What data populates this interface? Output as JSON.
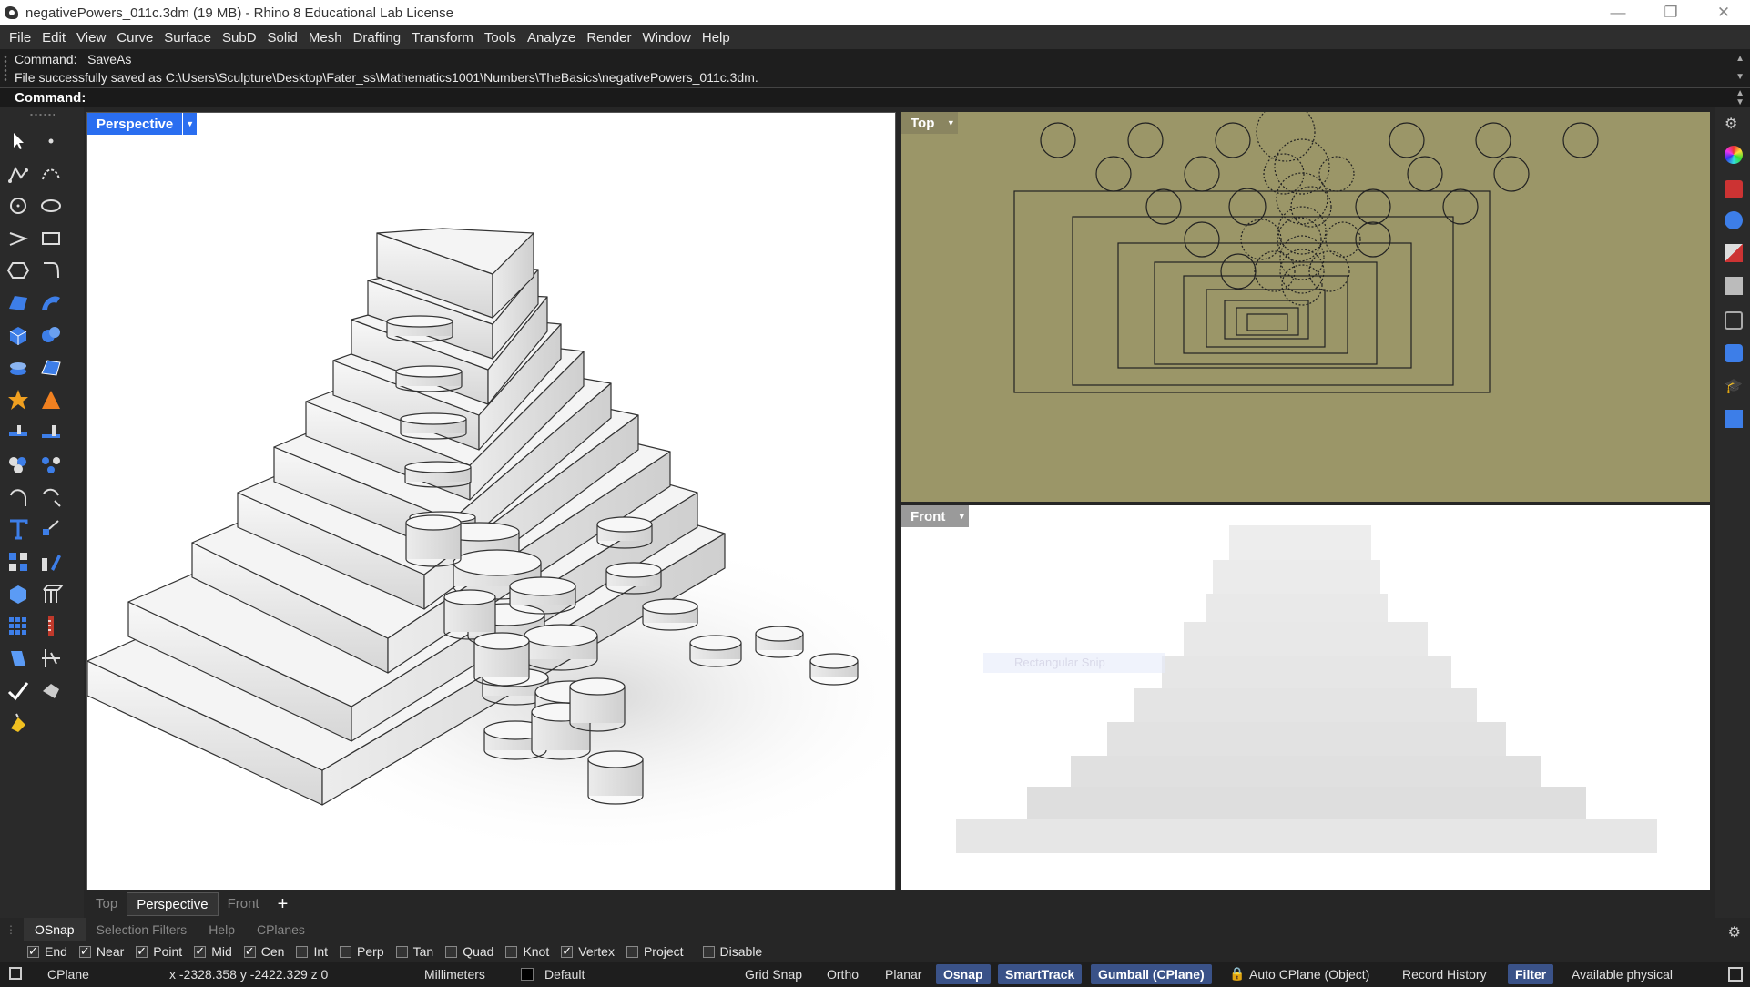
{
  "window": {
    "title": "negativePowers_011c.3dm (19 MB) - Rhino 8 Educational Lab License",
    "minimize": "—",
    "restore": "❐",
    "close": "✕"
  },
  "menu": [
    "File",
    "Edit",
    "View",
    "Curve",
    "Surface",
    "SubD",
    "Solid",
    "Mesh",
    "Drafting",
    "Transform",
    "Tools",
    "Analyze",
    "Render",
    "Window",
    "Help"
  ],
  "command": {
    "history_1": "Command: _SaveAs",
    "history_2": "File successfully saved as C:\\Users\\Sculpture\\Desktop\\Fater_ss\\Mathematics1001\\Numbers\\TheBasics\\negativePowers_011c.3dm.",
    "prompt": "Command:"
  },
  "viewports": {
    "perspective": "Perspective",
    "top": "Top",
    "front": "Front",
    "snip_hint": "Rectangular Snip"
  },
  "viewport_tabs": [
    "Top",
    "Perspective",
    "Front"
  ],
  "viewport_tab_add": "+",
  "panel_tabs": [
    "OSnap",
    "Selection Filters",
    "Help",
    "CPlanes"
  ],
  "osnaps": [
    {
      "label": "End",
      "checked": true
    },
    {
      "label": "Near",
      "checked": true
    },
    {
      "label": "Point",
      "checked": true
    },
    {
      "label": "Mid",
      "checked": true
    },
    {
      "label": "Cen",
      "checked": true
    },
    {
      "label": "Int",
      "checked": false
    },
    {
      "label": "Perp",
      "checked": false
    },
    {
      "label": "Tan",
      "checked": false
    },
    {
      "label": "Quad",
      "checked": false
    },
    {
      "label": "Knot",
      "checked": false
    },
    {
      "label": "Vertex",
      "checked": true
    },
    {
      "label": "Project",
      "checked": false
    },
    {
      "label": "Disable",
      "checked": false
    }
  ],
  "status": {
    "cplane": "CPlane",
    "coords": "x -2328.358   y -2422.329   z 0",
    "units": "Millimeters",
    "layer": "Default",
    "grid_snap": "Grid Snap",
    "ortho": "Ortho",
    "planar": "Planar",
    "osnap": "Osnap",
    "smarttrack": "SmartTrack",
    "gumball": "Gumball (CPlane)",
    "auto_cplane": "Auto CPlane (Object)",
    "record_history": "Record History",
    "filter": "Filter",
    "memory": "Available physical"
  },
  "colors": {
    "active_tab": "#2a6ef0",
    "top_viewport_bg": "#9b9668",
    "status_highlight": "#3a5288"
  }
}
